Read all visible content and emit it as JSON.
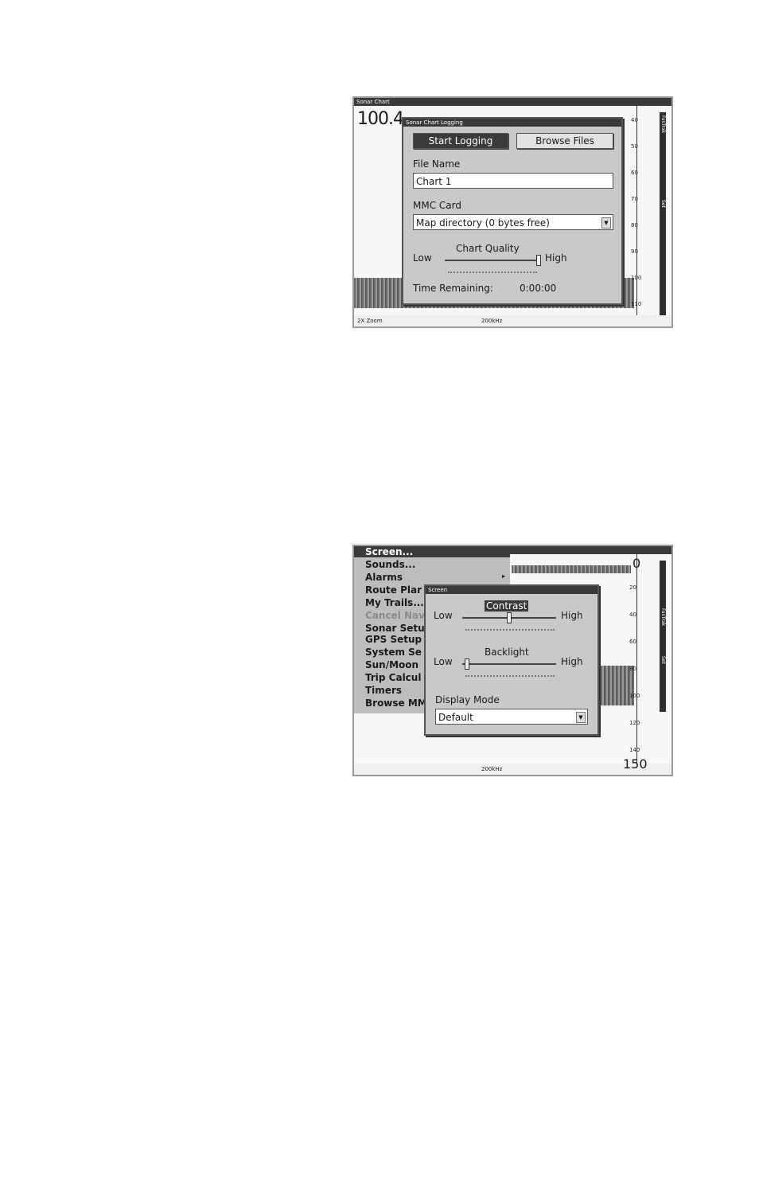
{
  "top": {
    "window_title": "Sonar Chart",
    "depth_readout": "100.4",
    "bottom_left": "2X Zoom",
    "bottom_center": "200kHz",
    "scale_ticks": [
      "40",
      "50",
      "60",
      "70",
      "80",
      "90",
      "100",
      "110"
    ],
    "sidebar_labels": [
      "FasTrak",
      "Set"
    ],
    "dialog": {
      "title": "Sonar Chart Logging",
      "start_button": "Start Logging",
      "browse_button": "Browse Files",
      "file_name_label": "File Name",
      "file_name_value": "Chart 1",
      "mmc_label": "MMC Card",
      "mmc_value": "Map directory (0 bytes free)",
      "quality_label": "Chart Quality",
      "low": "Low",
      "high": "High",
      "quality_level": 1.0,
      "time_label": "Time Remaining:",
      "time_value": "0:00:00"
    }
  },
  "bottom": {
    "depth_top": "0",
    "depth_bottom": "150",
    "bottom_center": "200kHz",
    "scale_ticks": [
      "20",
      "40",
      "60",
      "80",
      "100",
      "120",
      "140"
    ],
    "sidebar_labels": [
      "FasTrak",
      "Set"
    ],
    "menu_items": [
      {
        "label": "Screen...",
        "selected": true,
        "dim": false
      },
      {
        "label": "Sounds...",
        "selected": false,
        "dim": false
      },
      {
        "label": "Alarms",
        "selected": false,
        "dim": false
      },
      {
        "label": "Route Plar",
        "selected": false,
        "dim": false
      },
      {
        "label": "My Trails...",
        "selected": false,
        "dim": false
      },
      {
        "label": "Cancel Nav",
        "selected": false,
        "dim": true
      },
      {
        "label": "Sonar Setu",
        "selected": false,
        "dim": false
      },
      {
        "label": "GPS Setup",
        "selected": false,
        "dim": false
      },
      {
        "label": "System Se",
        "selected": false,
        "dim": false
      },
      {
        "label": "Sun/Moon",
        "selected": false,
        "dim": false
      },
      {
        "label": "Trip Calcul",
        "selected": false,
        "dim": false
      },
      {
        "label": "Timers",
        "selected": false,
        "dim": false
      },
      {
        "label": "Browse MM",
        "selected": false,
        "dim": false
      }
    ],
    "dialog": {
      "title": "Screen",
      "contrast_label": "Contrast",
      "backlight_label": "Backlight",
      "low": "Low",
      "high": "High",
      "contrast_level": 0.5,
      "backlight_level": 0.05,
      "display_mode_label": "Display Mode",
      "display_mode_value": "Default"
    }
  }
}
